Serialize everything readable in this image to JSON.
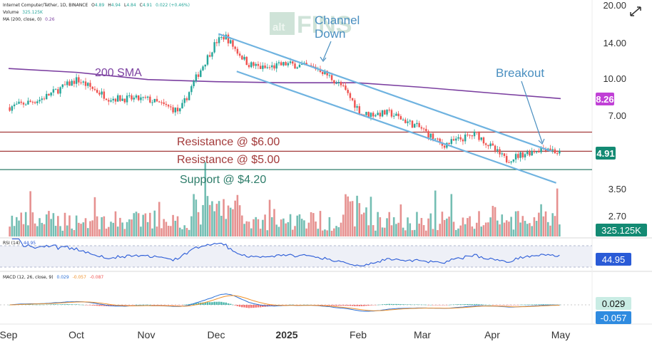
{
  "header": {
    "symbol_line": "Internet Computer/Tether, 1D, BINANCE",
    "o_label": "O",
    "o_value": "4.89",
    "h_label": "H",
    "h_value": "4.94",
    "l_label": "L",
    "l_value": "4.84",
    "c_label": "C",
    "c_value": "4.91",
    "change": "0.022 (+0.46%)",
    "volume_label": "Volume",
    "volume_value": "325.125K",
    "ma_label": "MA (200, close, 0)",
    "ma_value": "0.26"
  },
  "watermark": {
    "text": "FINS",
    "badge": "alt"
  },
  "annotations": {
    "channel_down_line1": "Channel",
    "channel_down_line2": "Down",
    "breakout": "Breakout",
    "sma_label": "200 SMA",
    "resistance_6": "Resistance @ $6.00",
    "resistance_5": "Resistance @ $5.00",
    "support_42": "Support @ $4.20"
  },
  "price_axis": [
    "20.00",
    "14.00",
    "10.00",
    "7.00",
    "3.50",
    "2.70"
  ],
  "badges": {
    "sma_value": "8.26",
    "last_price": "4.91",
    "volume": "325.125K",
    "rsi": "44.95",
    "macd": "0.029",
    "signal": "-0.057"
  },
  "rsi_panel": {
    "label": "RSI (14)",
    "value": "44.95"
  },
  "macd_panel": {
    "label": "MACD (12, 26, close, 9)",
    "macd": "0.029",
    "signal": "-0.057",
    "hist": "-0.087"
  },
  "months": [
    "Sep",
    "Oct",
    "Nov",
    "Dec",
    "2025",
    "Feb",
    "Mar",
    "Apr",
    "May"
  ],
  "colors": {
    "up": "#26a69a",
    "down": "#ef5350",
    "sma": "#7b3fa0",
    "channel": "#6fb3e0",
    "resistance": "#a33a3a",
    "support": "#2e7d6a",
    "rsi": "#2a5bd7",
    "macd": "#2a6fd6",
    "signal": "#f0922b"
  },
  "chart_data": {
    "type": "candlestick",
    "title": "Internet Computer/Tether, 1D, BINANCE",
    "scale": "log",
    "x_range": [
      "2024-09-01",
      "2025-05-01"
    ],
    "y_ticks": [
      20.0,
      14.0,
      10.0,
      7.0,
      3.5,
      2.7
    ],
    "close_path": [
      [
        "2024-09-01",
        7.6
      ],
      [
        "2024-09-15",
        8.2
      ],
      [
        "2024-10-01",
        9.9
      ],
      [
        "2024-10-15",
        8.3
      ],
      [
        "2024-11-01",
        8.2
      ],
      [
        "2024-11-15",
        7.3
      ],
      [
        "2024-11-22",
        10.0
      ],
      [
        "2024-12-01",
        14.2
      ],
      [
        "2024-12-05",
        15.0
      ],
      [
        "2024-12-10",
        13.0
      ],
      [
        "2024-12-15",
        11.5
      ],
      [
        "2024-12-22",
        11.0
      ],
      [
        "2025-01-01",
        11.5
      ],
      [
        "2025-01-15",
        11.0
      ],
      [
        "2025-01-25",
        9.3
      ],
      [
        "2025-02-03",
        7.1
      ],
      [
        "2025-02-15",
        7.2
      ],
      [
        "2025-03-01",
        6.2
      ],
      [
        "2025-03-10",
        5.3
      ],
      [
        "2025-03-25",
        5.9
      ],
      [
        "2025-04-07",
        4.6
      ],
      [
        "2025-04-15",
        4.9
      ],
      [
        "2025-04-25",
        5.2
      ],
      [
        "2025-04-30",
        4.91
      ]
    ],
    "sma_200": [
      [
        "2024-09-01",
        11.0
      ],
      [
        "2024-10-01",
        10.6
      ],
      [
        "2024-11-01",
        9.9
      ],
      [
        "2024-12-01",
        9.7
      ],
      [
        "2025-01-01",
        9.6
      ],
      [
        "2025-02-01",
        9.6
      ],
      [
        "2025-03-01",
        9.2
      ],
      [
        "2025-04-01",
        8.7
      ],
      [
        "2025-05-01",
        8.26
      ]
    ],
    "horizontal_levels": [
      {
        "label": "Resistance @ $6.00",
        "value": 6.0
      },
      {
        "label": "Resistance @ $5.00",
        "value": 5.0
      },
      {
        "label": "Support @ $4.20",
        "value": 4.2
      }
    ],
    "channel_upper": [
      [
        "2024-12-02",
        15.3
      ],
      [
        "2025-04-27",
        5.0
      ]
    ],
    "channel_lower": [
      [
        "2024-12-10",
        10.7
      ],
      [
        "2025-04-29",
        3.7
      ]
    ],
    "last_price": 4.91,
    "volume_last": "325.125K",
    "rsi_14_last": 44.95,
    "macd_last": 0.029,
    "signal_last": -0.057,
    "hist_last": -0.087
  }
}
